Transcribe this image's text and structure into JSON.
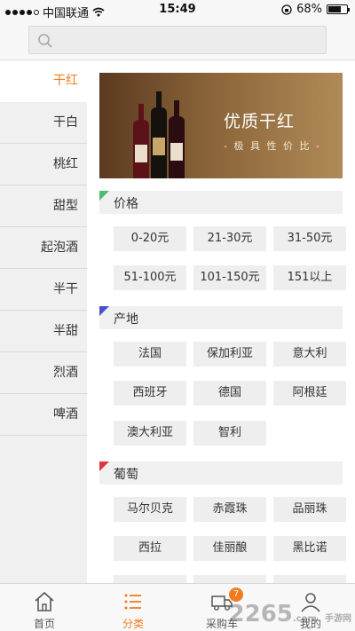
{
  "status_bar": {
    "carrier": "中国联通",
    "time": "15:49",
    "battery": "68%",
    "battery_level": 0.68
  },
  "search": {
    "placeholder": ""
  },
  "sidebar": {
    "items": [
      {
        "label": "干红"
      },
      {
        "label": "干白"
      },
      {
        "label": "桃红"
      },
      {
        "label": "甜型"
      },
      {
        "label": "起泡酒"
      },
      {
        "label": "半干"
      },
      {
        "label": "半甜"
      },
      {
        "label": "烈酒"
      },
      {
        "label": "啤酒"
      }
    ],
    "active_index": 0
  },
  "banner": {
    "title": "优质干红",
    "subtitle": "- 极 具 性 价 比 -"
  },
  "sections": {
    "price": {
      "title": "价格",
      "color": "#4cbf6a",
      "tags": [
        "0-20元",
        "21-30元",
        "31-50元",
        "51-100元",
        "101-150元",
        "151以上"
      ]
    },
    "origin": {
      "title": "产地",
      "color": "#4a4fd0",
      "tags": [
        "法国",
        "保加利亚",
        "意大利",
        "西班牙",
        "德国",
        "阿根廷",
        "澳大利亚",
        "智利"
      ]
    },
    "grape": {
      "title": "葡萄",
      "color": "#e0343f",
      "tags": [
        "马尔贝克",
        "赤霞珠",
        "品丽珠",
        "西拉",
        "佳丽酿",
        "黑比诺"
      ]
    }
  },
  "tabbar": {
    "home": "首页",
    "category": "分类",
    "cart": "采购车",
    "cart_badge": "7",
    "mine": "我的"
  },
  "watermark": {
    "text": "2265",
    "suffix": ".com",
    "site": "手游网"
  },
  "colors": {
    "accent": "#f27b1f"
  }
}
